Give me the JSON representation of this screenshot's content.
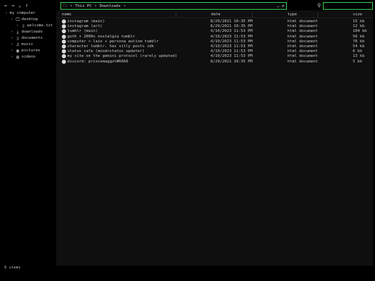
{
  "toolbar": {
    "back_icon": "←",
    "forward_icon": "→",
    "history_icon": "⌄",
    "up_icon": "↑",
    "breadcrumb": [
      "This PC",
      "Downloads"
    ],
    "dropdown_icon": "⌄",
    "refresh_icon": "↺",
    "search_icon": "⚲",
    "search_placeholder": ""
  },
  "sidebar": {
    "root_label": "my computer",
    "items": [
      {
        "label": "desktop",
        "icon": "desktop-icon"
      },
      {
        "label": "welcome.txt",
        "icon": "file-icon"
      },
      {
        "label": "downloads",
        "icon": "download-icon"
      },
      {
        "label": "documents",
        "icon": "document-icon"
      },
      {
        "label": "music",
        "icon": "music-icon"
      },
      {
        "label": "pictures",
        "icon": "image-icon"
      },
      {
        "label": "videos",
        "icon": "video-icon"
      }
    ]
  },
  "columns": {
    "name": "name",
    "date": "date",
    "type": "type",
    "size": "size"
  },
  "files": [
    {
      "name": "instagram (main)",
      "date": "8/29/2021 10:35 PM",
      "type": "html document",
      "size": "15 kb"
    },
    {
      "name": "instagram (art)",
      "date": "8/29/2021 10:35 PM",
      "type": "html document",
      "size": "12 kb"
    },
    {
      "name": "tumblr (main)",
      "date": "4/10/2023 11:53 PM",
      "type": "html document",
      "size": "104 kb"
    },
    {
      "name": "goth + 2000s nostalgia tumblr",
      "date": "4/10/2023 11:53 PM",
      "type": "html document",
      "size": "56 kb"
    },
    {
      "name": "computer + lain + persona autism tumblr",
      "date": "4/10/2023 11:53 PM",
      "type": "html document",
      "size": "76 kb"
    },
    {
      "name": "character tumblr. has silly posts idk",
      "date": "4/10/2023 11:53 PM",
      "type": "html document",
      "size": "54 kb"
    },
    {
      "name": "status cafe (mood+status updater)",
      "date": "4/10/2023 11:53 PM",
      "type": "html document",
      "size": "6 kb"
    },
    {
      "name": "my site on the gemini protocol (rarely updated)",
      "date": "4/10/2023 11:53 PM",
      "type": "html document",
      "size": "13 kb"
    },
    {
      "name": "discord: princemaggot#6666",
      "date": "8/29/2021 10:35 PM",
      "type": "html document",
      "size": "5 kb"
    }
  ],
  "status": {
    "item_count": "9 items"
  },
  "colors": {
    "accent": "#39d353",
    "background": "#000000",
    "panel": "#0f0f0f"
  }
}
